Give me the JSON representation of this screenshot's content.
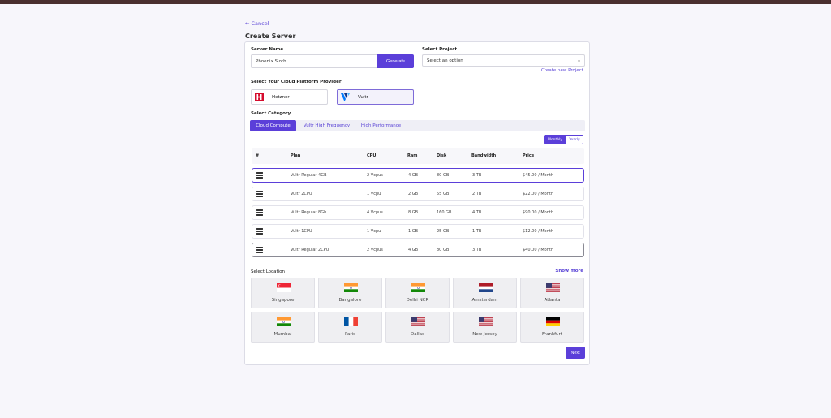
{
  "header": {
    "cancel_label": "← Cancel",
    "title": "Create Server"
  },
  "form": {
    "server_name_label": "Server Name",
    "server_name_value": "Phoenix Sloth",
    "generate_label": "Generate",
    "project_label": "Select Project",
    "project_placeholder": "Select an option",
    "create_project_label": "Create new Project",
    "provider_label": "Select Your Cloud Platform Provider",
    "providers": [
      {
        "name": "Hetzner",
        "selected": false
      },
      {
        "name": "Vultr",
        "selected": true
      }
    ],
    "category_label": "Select Category",
    "categories": [
      "Cloud Compute",
      "Vultr High Frequency",
      "High Performance"
    ],
    "billing": {
      "monthly": "Monthly",
      "yearly": "Yearly"
    }
  },
  "plans_table": {
    "headers": [
      "#",
      "Plan",
      "CPU",
      "Ram",
      "Disk",
      "Bandwidth",
      "Price"
    ],
    "rows": [
      {
        "plan": "Vultr Regular 4GB",
        "cpu": "2 Vcpus",
        "ram": "4 GB",
        "disk": "80 GB",
        "bandwidth": "3 TB",
        "price": "$45.00 / Month"
      },
      {
        "plan": "Vultr 2CPU",
        "cpu": "1 Vcpu",
        "ram": "2 GB",
        "disk": "55 GB",
        "bandwidth": "2 TB",
        "price": "$22.00 / Month"
      },
      {
        "plan": "Vultr Regular 8Gb",
        "cpu": "4 Vcpus",
        "ram": "8 GB",
        "disk": "160 GB",
        "bandwidth": "4 TB",
        "price": "$90.00 / Month"
      },
      {
        "plan": "Vultr 1CPU",
        "cpu": "1 Vcpu",
        "ram": "1 GB",
        "disk": "25 GB",
        "bandwidth": "1 TB",
        "price": "$12.00 / Month"
      },
      {
        "plan": "Vultr Regular 2CPU",
        "cpu": "2 Vcpus",
        "ram": "4 GB",
        "disk": "80 GB",
        "bandwidth": "3 TB",
        "price": "$40.00 / Month"
      }
    ]
  },
  "location": {
    "label": "Select Location",
    "show_more": "Show more",
    "items": [
      {
        "name": "Singapore",
        "flag": "sg"
      },
      {
        "name": "Bangalore",
        "flag": "in"
      },
      {
        "name": "Delhi NCR",
        "flag": "in"
      },
      {
        "name": "Amsterdam",
        "flag": "nl"
      },
      {
        "name": "Atlanta",
        "flag": "us"
      },
      {
        "name": "Mumbai",
        "flag": "in"
      },
      {
        "name": "Paris",
        "flag": "fr"
      },
      {
        "name": "Dallas",
        "flag": "us"
      },
      {
        "name": "New Jersey",
        "flag": "us"
      },
      {
        "name": "Frankfurt",
        "flag": "de"
      }
    ]
  },
  "footer": {
    "next_label": "Next"
  },
  "colors": {
    "accent": "#5b3fd9",
    "topbar": "#4a2f2f",
    "hetzner": "#d50c2d",
    "vultr": "#007bfc"
  }
}
